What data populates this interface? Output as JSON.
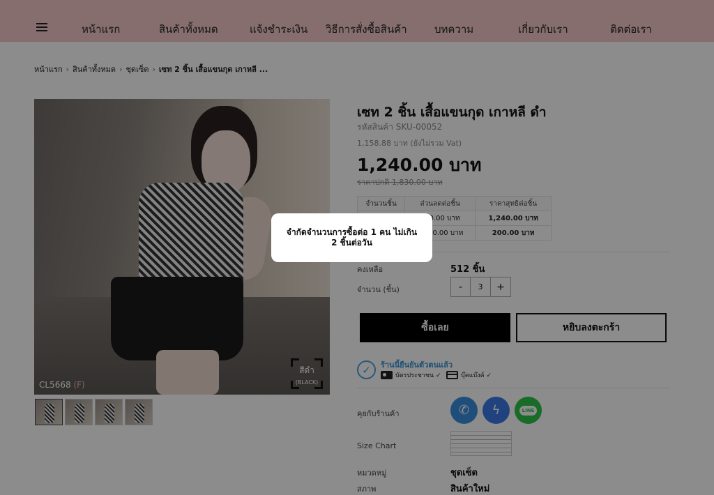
{
  "nav": {
    "items": [
      "หน้าแรก",
      "สินค้าทั้งหมด",
      "แจ้งชำระเงิน",
      "วิธีการสั่งซื้อสินค้า",
      "บทความ",
      "เกี่ยวกับเรา",
      "ติดต่อเรา"
    ]
  },
  "breadcrumb": {
    "items": [
      "หน้าแรก",
      "สินค้าทั้งหมด",
      "ชุดเซ็ต"
    ],
    "current": "เซท 2 ชิ้น เสื้อแขนกุด เกาหลี ..."
  },
  "gallery": {
    "code": "CL5668",
    "code_suffix": "(F)",
    "color_label": "สีดำ",
    "color_sub": "(BLACK)",
    "thumb_count": 4
  },
  "product": {
    "title": "เซท 2 ชิ้น เสื้อแขนกุด เกาหลี ดำ",
    "sku": "รหัสสินค้า SKU-00052",
    "price_no_vat": "1,158.88 บาท (ยังไม่รวม Vat)",
    "price": "1,240.00 บาท",
    "normal_price": "ราคาปกติ 1,830.00 บาท"
  },
  "tiers": {
    "headers": [
      "จำนวนชิ้น",
      "ส่วนลดต่อชิ้น",
      "ราคาสุทธิต่อชิ้น"
    ],
    "rows": [
      [
        "",
        "590.00  บาท",
        "1,240.00 บาท"
      ],
      [
        "",
        "1,630.00  บาท",
        "200.00 บาท"
      ]
    ]
  },
  "stock": {
    "label": "คงเหลือ",
    "value": "512 ชิ้น"
  },
  "quantity": {
    "label": "จำนวน (ชิ้น)",
    "minus": "-",
    "value": "3",
    "plus": "+"
  },
  "buttons": {
    "buy": "ซื้อเลย",
    "cart": "หยิบลงตะกร้า"
  },
  "verification": {
    "text": "ร้านนี้ยืนยันตัวตนแล้ว",
    "id_card": "บัตรประชาชน ✓",
    "bank": "บุ๊คแบ๊งค์ ✓",
    "check": "✓"
  },
  "contact": {
    "label": "คุยกับร้านค้า",
    "line_text": "LINE",
    "phone_glyph": "✆",
    "messenger_glyph": "ϟ"
  },
  "size_chart": {
    "label": "Size Chart"
  },
  "category": {
    "label": "หมวดหมู่",
    "value": "ชุดเซ็ต"
  },
  "status": {
    "label": "สภาพ",
    "value": "สินค้าใหม่"
  },
  "modal": {
    "message": "จำกัดจำนวนการซื้อต่อ 1 คน ไม่เกิน 2 ชิ้นต่อวัน"
  }
}
